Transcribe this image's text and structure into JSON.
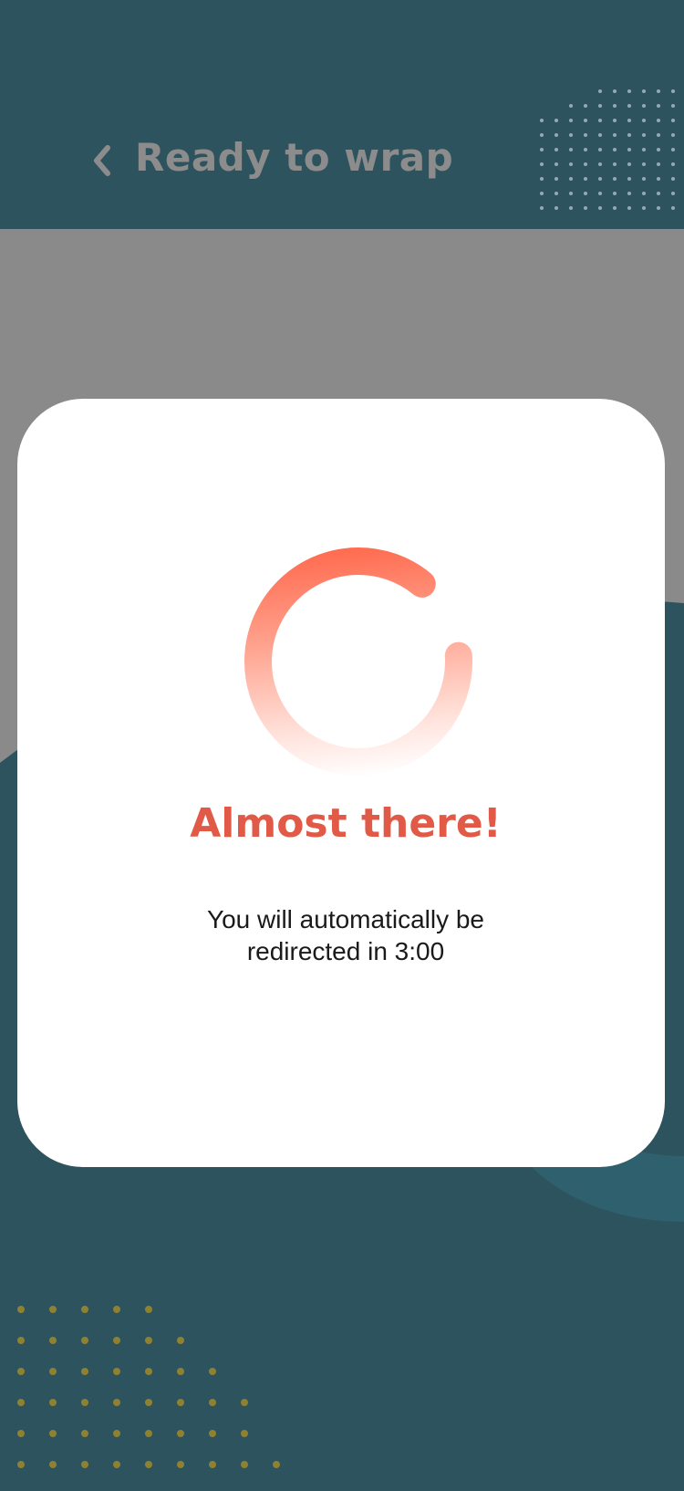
{
  "header": {
    "title": "Ready to wrap",
    "back_icon": "chevron-left-icon"
  },
  "modal": {
    "title": "Almost there!",
    "message_line1": "You will automatically be",
    "message_line2": "redirected in 3:00",
    "spinner_icon": "loading-spinner-icon"
  },
  "colors": {
    "background": "#2d535e",
    "overlay": "#8a8a8a",
    "title_accent": "#e05a47",
    "spinner": "#ff5a3c",
    "dots_gold": "#a08a2a"
  }
}
